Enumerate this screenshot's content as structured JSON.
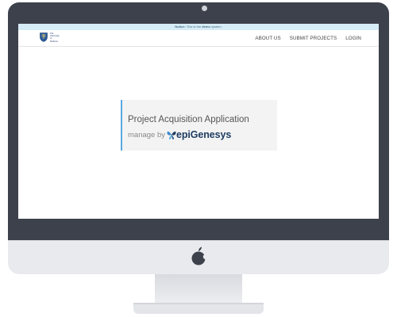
{
  "notice": {
    "label": "Notice:",
    "text_before": " This is the ",
    "emphasis": "demo",
    "text_after": " system."
  },
  "logo": {
    "name": "The University of Madison",
    "icon": "university-crest-icon"
  },
  "nav": {
    "items": [
      {
        "label": "ABOUT US"
      },
      {
        "label": "SUBMIT PROJECTS"
      },
      {
        "label": "LOGIN"
      }
    ]
  },
  "hero": {
    "title": "Project Acquisition Application",
    "manage_label": "manage by",
    "brand": "epiGenesys",
    "brand_icon": "butterfly-icon"
  },
  "colors": {
    "notice_bg": "#d6ecf7",
    "hero_accent": "#5aa9de",
    "brand": "#1f3d60",
    "bezel": "#3d414b"
  },
  "device": {
    "icon": "apple-logo-icon"
  }
}
